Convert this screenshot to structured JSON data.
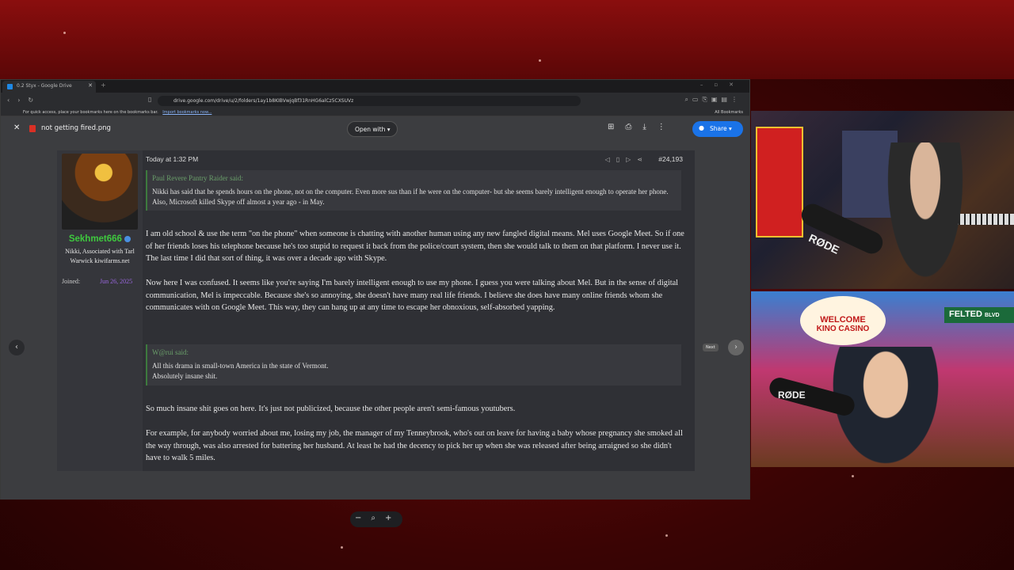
{
  "browser": {
    "tab_title": "0.2 Styx - Google Drive",
    "url": "drive.google.com/drive/u/2/folders/1ay1b8KIBVwjqBf31RnHG6alCz5CXSUVz",
    "bookmarks_text": "For quick access, place your bookmarks here on the bookmarks bar.",
    "bookmarks_link": "Import bookmarks now...",
    "all_bookmarks": "All Bookmarks"
  },
  "viewer": {
    "file_name": "not getting fired.png",
    "open_with": "Open with",
    "share": "Share",
    "next_tooltip": "Next"
  },
  "post": {
    "username": "Sekhmet666",
    "user_title": "Nikki, Associated with Tarl Warwick kiwifarms.net",
    "joined_label": "Joined:",
    "joined_date": "Jun 26, 2025",
    "timestamp": "Today at 1:32 PM",
    "post_number": "#24,193",
    "quote1_author": "Paul Revere Pantry Raider said:",
    "quote1_text": "Nikki has said that he spends hours on the phone, not on the computer. Even more sus than if he were on the computer- but she seems barely intelligent enough to operate her phone. Also, Microsoft killed Skype off almost a year ago - in May.",
    "para1": "I am old school & use the term \"on the phone\" when someone is chatting with another human using any new fangled digital means. Mel uses Google Meet. So if one of her friends loses his telephone because he's too stupid to request it back from the police/court system, then she would talk to them on that platform. I never use it. The last time I did that sort of thing, it was over a decade ago with Skype.",
    "para2": "Now here I was confused. It seems like you're saying I'm barely intelligent enough to use my phone. I guess you were talking about Mel. But in the sense of digital communication, Mel is impeccable. Because she's so annoying, she doesn't have many real life friends. I believe she does have many online friends whom she communicates with on Google Meet. This way, they can hang up at any time to escape her obnoxious, self-absorbed yapping.",
    "quote2_author": "W@rui said:",
    "quote2_line1": "All this drama in small-town America in the state of Vermont.",
    "quote2_line2": "Absolutely insane shit.",
    "para3": "So much insane shit goes on here. It's just not publicized, because the other people aren't semi-famous youtubers.",
    "para4": "For example, for anybody worried about me, losing my job, the manager of my Tenneybrook, who's out on leave for having a baby whose pregnancy she smoked all the way through, was also arrested for battering her husband. At least he had the decency to pick her up when she was released after being arraigned so she didn't have to walk 5 miles."
  },
  "webcam_top": {
    "brand": "RØDE"
  },
  "webcam_bottom": {
    "sign1": "WELCOME",
    "sign2": "KINO CASINO",
    "sign3": "FELTED",
    "sign4": "BLVD",
    "brand": "RØDE"
  }
}
